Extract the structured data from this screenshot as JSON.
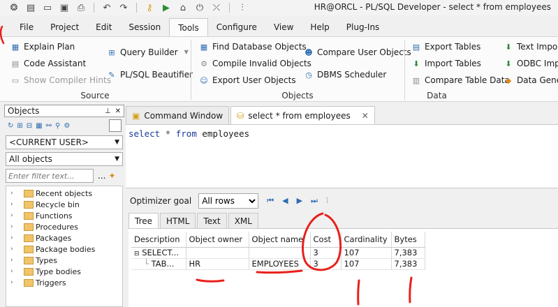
{
  "window": {
    "title": "HR@ORCL - PL/SQL Developer - select * from employees"
  },
  "menu_tabs": [
    "File",
    "Project",
    "Edit",
    "Session",
    "Tools",
    "Configure",
    "View",
    "Help",
    "Plug-Ins"
  ],
  "ribbon": {
    "source": {
      "title": "Source",
      "explain_plan": "Explain Plan",
      "code_assistant": "Code Assistant",
      "show_compiler_hints": "Show Compiler Hints",
      "query_builder": "Query Builder",
      "plsql_beautifier": "PL/SQL Beautifier"
    },
    "objects": {
      "title": "Objects",
      "find_database_objects": "Find Database Objects",
      "compile_invalid_objects": "Compile Invalid Objects",
      "export_user_objects": "Export User Objects",
      "compare_user_objects": "Compare User Objects",
      "dbms_scheduler": "DBMS Scheduler"
    },
    "data": {
      "title": "Data",
      "export_tables": "Export Tables",
      "import_tables": "Import Tables",
      "compare_table_data": "Compare Table Data",
      "text_importer": "Text Import",
      "odbc_importer": "ODBC Impo",
      "data_generator": "Data Gener"
    }
  },
  "objects_panel": {
    "title": "Objects",
    "user_select": "<CURRENT USER>",
    "type_select": "All objects",
    "filter_placeholder": "Enter filter text...",
    "more": "...",
    "tree": [
      "Recent objects",
      "Recycle bin",
      "Functions",
      "Procedures",
      "Packages",
      "Package bodies",
      "Types",
      "Type bodies",
      "Triggers"
    ]
  },
  "editor_tabs": {
    "command_window": "Command Window",
    "sql_window": "select * from employees"
  },
  "sql": {
    "kw_select": "select",
    "star": "*",
    "kw_from": "from",
    "table": "employees"
  },
  "optimizer": {
    "label": "Optimizer goal",
    "value": "All rows"
  },
  "result_tabs": [
    "Tree",
    "HTML",
    "Text",
    "XML"
  ],
  "plan": {
    "columns": [
      "Description",
      "Object owner",
      "Object name",
      "Cost",
      "Cardinality",
      "Bytes"
    ],
    "rows": [
      [
        "SELECT...",
        "",
        "",
        "3",
        "107",
        "7,383"
      ],
      [
        "TAB...",
        "HR",
        "EMPLOYEES",
        "3",
        "107",
        "7,383"
      ]
    ]
  },
  "colors": {
    "annotation": "#e8201c",
    "accent": "#2b6cb0"
  }
}
